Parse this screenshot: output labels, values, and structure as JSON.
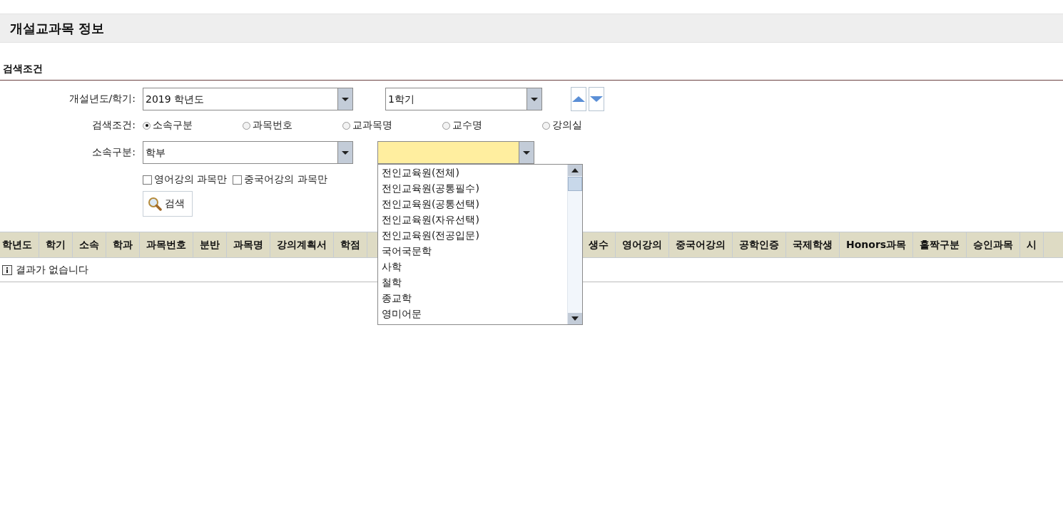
{
  "page_title": "개설교과목 정보",
  "section_title": "검색조건",
  "year_term": {
    "label": "개설년도/학기:",
    "year": "2019 학년도",
    "term": "1학기"
  },
  "search_by": {
    "label": "검색조건:",
    "options": [
      {
        "label": "소속구분",
        "selected": true
      },
      {
        "label": "과목번호",
        "selected": false
      },
      {
        "label": "교과목명",
        "selected": false
      },
      {
        "label": "교수명",
        "selected": false
      },
      {
        "label": "강의실",
        "selected": false
      }
    ]
  },
  "affiliation": {
    "label": "소속구분:",
    "value": "학부",
    "dropdown_open": true,
    "dropdown_items": [
      "전인교육원(전체)",
      "전인교육원(공통필수)",
      "전인교육원(공통선택)",
      "전인교육원(자유선택)",
      "전인교육원(전공입문)",
      "국어국문학",
      "사학",
      "철학",
      "종교학",
      "영미어문"
    ]
  },
  "filters": [
    {
      "label": "영어강의 과목만",
      "checked": false
    },
    {
      "label": "중국어강의 과목만",
      "checked": false
    }
  ],
  "search_button": "검색",
  "table": {
    "columns_left": [
      "학년도",
      "학기",
      "소속",
      "학과",
      "과목번호",
      "분반",
      "과목명",
      "강의계획서",
      "학점"
    ],
    "columns_right": [
      "생수",
      "영어강의",
      "중국어강의",
      "공학인증",
      "국제학생",
      "Honors과목",
      "홀짝구분",
      "승인과목",
      "시"
    ],
    "empty_message": "결과가 없습니다"
  }
}
